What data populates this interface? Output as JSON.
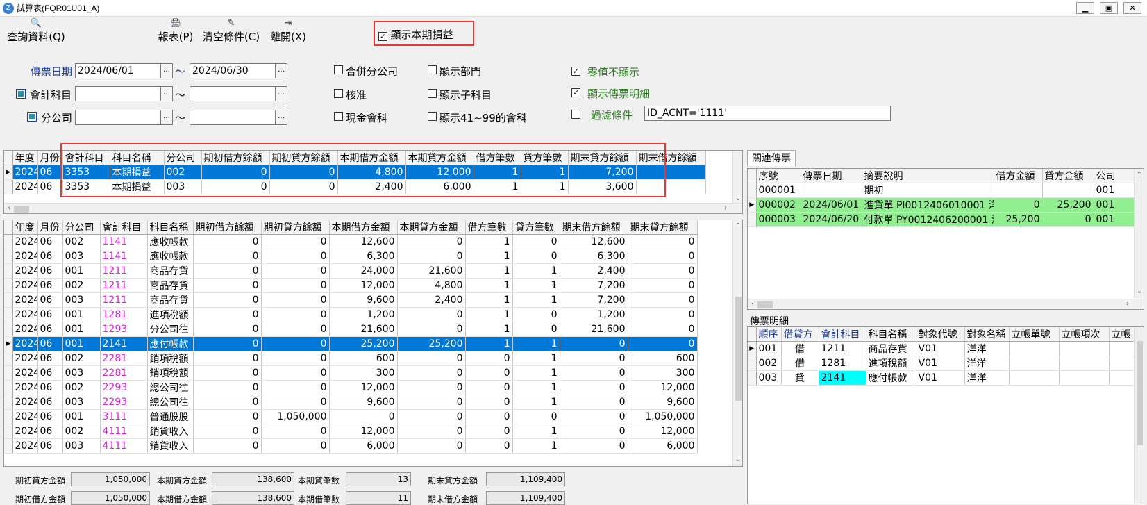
{
  "window": {
    "title": "試算表(FQR01U01_A)",
    "controls": [
      "▁",
      "▣",
      "✕"
    ]
  },
  "toolbar": {
    "query": "查詢資料(Q)",
    "report": "報表(P)",
    "clear": "清空條件(C)",
    "exit": "離開(X)",
    "show_pl": "顯示本期損益"
  },
  "filters": {
    "voucher_date_label": "傳票日期",
    "date_from": "2024/06/01",
    "date_to": "2024/06/30",
    "tilde": "～",
    "account_label": "會計科目",
    "account_from": "",
    "account_to": "",
    "branch_label": "分公司",
    "branch_from": "",
    "branch_to": "",
    "dots": "…",
    "merge_branch": "合併分公司",
    "approved": "核准",
    "cash_account": "現金會科",
    "show_dept": "顯示部門",
    "show_sub": "顯示子科目",
    "show_41_99": "顯示41~99的會科",
    "zero_hide": "零值不顯示",
    "show_voucher_detail": "顯示傳票明細",
    "filter_label": "過濾條件",
    "filter_value": "ID_ACNT='1111'"
  },
  "top_grid": {
    "columns": [
      "年度",
      "月份",
      "會計科目",
      "科目名稱",
      "分公司",
      "期初借方餘額",
      "期初貸方餘額",
      "本期借方金額",
      "本期貸方金額",
      "借方筆數",
      "貸方筆數",
      "期末貸方餘額",
      "期末借方餘額"
    ],
    "rows": [
      [
        "2024",
        "06",
        "3353",
        "本期損益",
        "002",
        "0",
        "0",
        "4,800",
        "12,000",
        "1",
        "1",
        "7,200",
        ""
      ],
      [
        "2024",
        "06",
        "3353",
        "本期損益",
        "003",
        "0",
        "0",
        "2,400",
        "6,000",
        "1",
        "1",
        "3,600",
        ""
      ]
    ]
  },
  "main_grid": {
    "columns": [
      "年度",
      "月份",
      "分公司",
      "會計科目",
      "科目名稱",
      "期初借方餘額",
      "期初貸方餘額",
      "本期借方金額",
      "本期貸方金額",
      "借方筆數",
      "貸方筆數",
      "期末借方餘額",
      "期末貸方餘額"
    ],
    "rows": [
      [
        "2024",
        "06",
        "002",
        "1141",
        "應收帳款",
        "0",
        "0",
        "12,600",
        "0",
        "1",
        "0",
        "12,600",
        "0"
      ],
      [
        "2024",
        "06",
        "003",
        "1141",
        "應收帳款",
        "0",
        "0",
        "6,300",
        "0",
        "1",
        "0",
        "6,300",
        "0"
      ],
      [
        "2024",
        "06",
        "001",
        "1211",
        "商品存貨",
        "0",
        "0",
        "24,000",
        "21,600",
        "1",
        "1",
        "2,400",
        "0"
      ],
      [
        "2024",
        "06",
        "002",
        "1211",
        "商品存貨",
        "0",
        "0",
        "12,000",
        "4,800",
        "1",
        "1",
        "7,200",
        "0"
      ],
      [
        "2024",
        "06",
        "003",
        "1211",
        "商品存貨",
        "0",
        "0",
        "9,600",
        "2,400",
        "1",
        "1",
        "7,200",
        "0"
      ],
      [
        "2024",
        "06",
        "001",
        "1281",
        "進項稅額",
        "0",
        "0",
        "1,200",
        "0",
        "1",
        "0",
        "1,200",
        "0"
      ],
      [
        "2024",
        "06",
        "001",
        "1293",
        "分公司往",
        "0",
        "0",
        "21,600",
        "0",
        "1",
        "0",
        "21,600",
        "0"
      ],
      [
        "2024",
        "06",
        "001",
        "2141",
        "應付帳款",
        "0",
        "0",
        "25,200",
        "25,200",
        "1",
        "1",
        "0",
        "0"
      ],
      [
        "2024",
        "06",
        "002",
        "2281",
        "銷項稅額",
        "0",
        "0",
        "600",
        "0",
        "0",
        "1",
        "0",
        "600"
      ],
      [
        "2024",
        "06",
        "003",
        "2281",
        "銷項稅額",
        "0",
        "0",
        "300",
        "0",
        "0",
        "1",
        "0",
        "300"
      ],
      [
        "2024",
        "06",
        "002",
        "2293",
        "總公司往",
        "0",
        "0",
        "12,000",
        "0",
        "0",
        "1",
        "0",
        "12,000"
      ],
      [
        "2024",
        "06",
        "003",
        "2293",
        "總公司往",
        "0",
        "0",
        "9,600",
        "0",
        "0",
        "1",
        "0",
        "9,600"
      ],
      [
        "2024",
        "06",
        "001",
        "3111",
        "普通股股",
        "0",
        "1,050,000",
        "0",
        "0",
        "0",
        "0",
        "0",
        "1,050,000"
      ],
      [
        "2024",
        "06",
        "002",
        "4111",
        "銷貨收入",
        "0",
        "0",
        "12,000",
        "0",
        "0",
        "1",
        "0",
        "12,000"
      ],
      [
        "2024",
        "06",
        "003",
        "4111",
        "銷貨收入",
        "0",
        "0",
        "6,000",
        "0",
        "0",
        "1",
        "0",
        "6,000"
      ]
    ]
  },
  "related": {
    "tab": "關連傳票",
    "columns": [
      "序號",
      "傳票日期",
      "摘要說明",
      "借方金額",
      "貸方金額",
      "公司"
    ],
    "rows": [
      [
        "000001",
        "",
        "期初",
        "",
        "",
        "001"
      ],
      [
        "000002",
        "2024/06/01",
        "進貨單 PI0012406010001 洋洋",
        "0",
        "25,200",
        "001"
      ],
      [
        "000003",
        "2024/06/20",
        "付款單 PY0012406200001 洋洋",
        "25,200",
        "0",
        "001"
      ]
    ]
  },
  "detail": {
    "title": "傳票明細",
    "columns": [
      "順序",
      "借貸方",
      "會計科目",
      "科目名稱",
      "對象代號",
      "對象名稱",
      "立帳單號",
      "立帳項次",
      "立帳"
    ],
    "rows": [
      [
        "001",
        "借",
        "1211",
        "商品存貨",
        "V01",
        "洋洋",
        "",
        "",
        ""
      ],
      [
        "002",
        "借",
        "1281",
        "進項稅額",
        "V01",
        "洋洋",
        "",
        "",
        ""
      ],
      [
        "003",
        "貸",
        "2141",
        "應付帳款",
        "V01",
        "洋洋",
        "",
        "",
        ""
      ]
    ]
  },
  "footer": {
    "open_credit_label": "期初貸方金額",
    "open_credit": "1,050,000",
    "cur_credit_label": "本期貸方金額",
    "cur_credit": "138,600",
    "cur_credit_cnt_label": "本期貸筆數",
    "cur_credit_cnt": "13",
    "end_credit_label": "期末貸方金額",
    "end_credit": "1,109,400",
    "open_debit_label": "期初借方金額",
    "open_debit": "1,050,000",
    "cur_debit_label": "本期借方金額",
    "cur_debit": "138,600",
    "cur_debit_cnt_label": "本期借筆數",
    "cur_debit_cnt": "11",
    "end_debit_label": "期末借方金額",
    "end_debit": "1,109,400"
  },
  "colors": {
    "selection": "#0078d7",
    "highlight_green": "#90ee90",
    "account_magenta": "#e020e0",
    "annotation_red": "#e53935"
  }
}
